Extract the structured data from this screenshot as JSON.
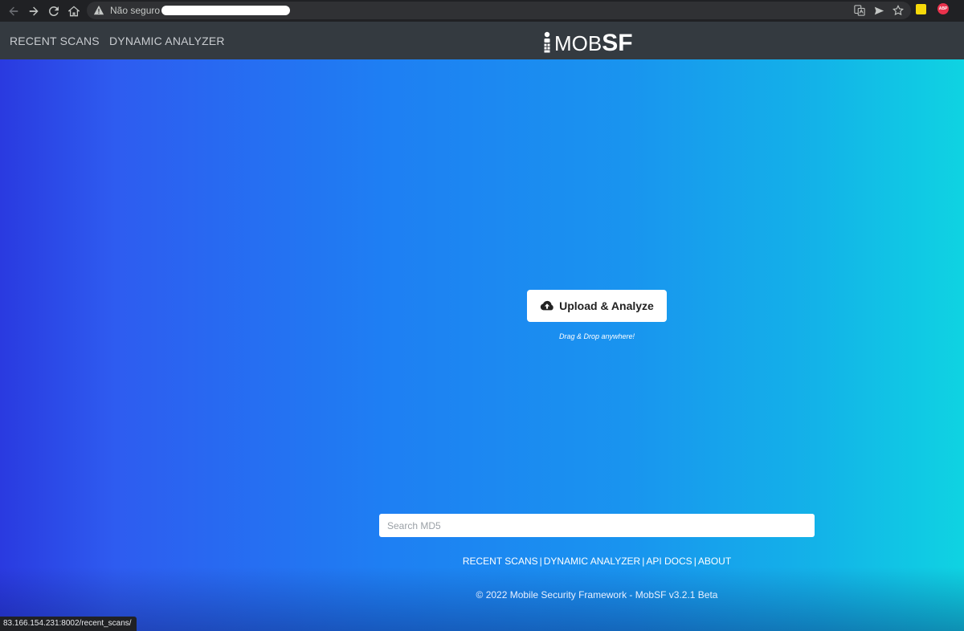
{
  "browser": {
    "security_label": "Não seguro",
    "status_url": "83.166.154.231:8002/recent_scans/"
  },
  "navbar": {
    "recent_scans": "RECENT SCANS",
    "dynamic_analyzer": "DYNAMIC ANALYZER",
    "logo_mob": "MOB",
    "logo_sf": "SF"
  },
  "main": {
    "upload_label": "Upload & Analyze",
    "drag_drop": "Drag & Drop anywhere!",
    "search_placeholder": "Search MD5"
  },
  "footer": {
    "links": [
      "RECENT SCANS",
      "DYNAMIC ANALYZER",
      "API DOCS",
      "ABOUT"
    ],
    "copyright": "© 2022 Mobile Security Framework - MobSF v3.2.1 Beta"
  },
  "colors": {
    "gradient_left": "#2a3ae0",
    "gradient_right": "#0fd3e2",
    "navbar_bg": "#343a40"
  },
  "icons": {
    "back": "arrow-left-icon",
    "forward": "arrow-right-icon",
    "reload": "reload-icon",
    "home": "home-icon",
    "warning": "warning-icon",
    "translate": "translate-icon",
    "send": "send-icon",
    "bookmark": "star-icon",
    "upload": "cloud-upload-icon"
  }
}
